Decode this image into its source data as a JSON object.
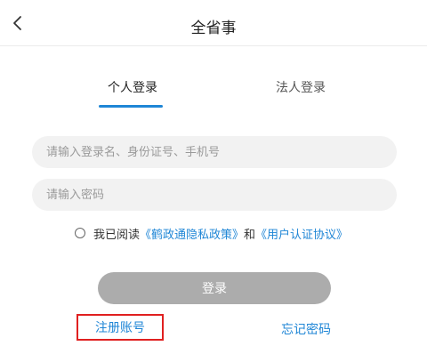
{
  "header": {
    "title": "全省事",
    "back_icon": "chevron-left-icon"
  },
  "tabs": [
    {
      "label": "个人登录",
      "active": true
    },
    {
      "label": "法人登录",
      "active": false
    }
  ],
  "form": {
    "account_placeholder": "请输入登录名、身份证号、手机号",
    "password_placeholder": "请输入密码",
    "account_value": "",
    "password_value": ""
  },
  "agreement": {
    "checked": false,
    "prefix": "我已阅读",
    "privacy_link": "《鹤政通隐私政策》",
    "and": "和",
    "user_link": "《用户认证协议》"
  },
  "buttons": {
    "login": "登录",
    "register": "注册账号",
    "forgot": "忘记密码"
  },
  "colors": {
    "accent": "#1f86d6",
    "login_disabled": "#acacac",
    "highlight_border": "#e02020",
    "input_bg": "#f2f2f2"
  }
}
